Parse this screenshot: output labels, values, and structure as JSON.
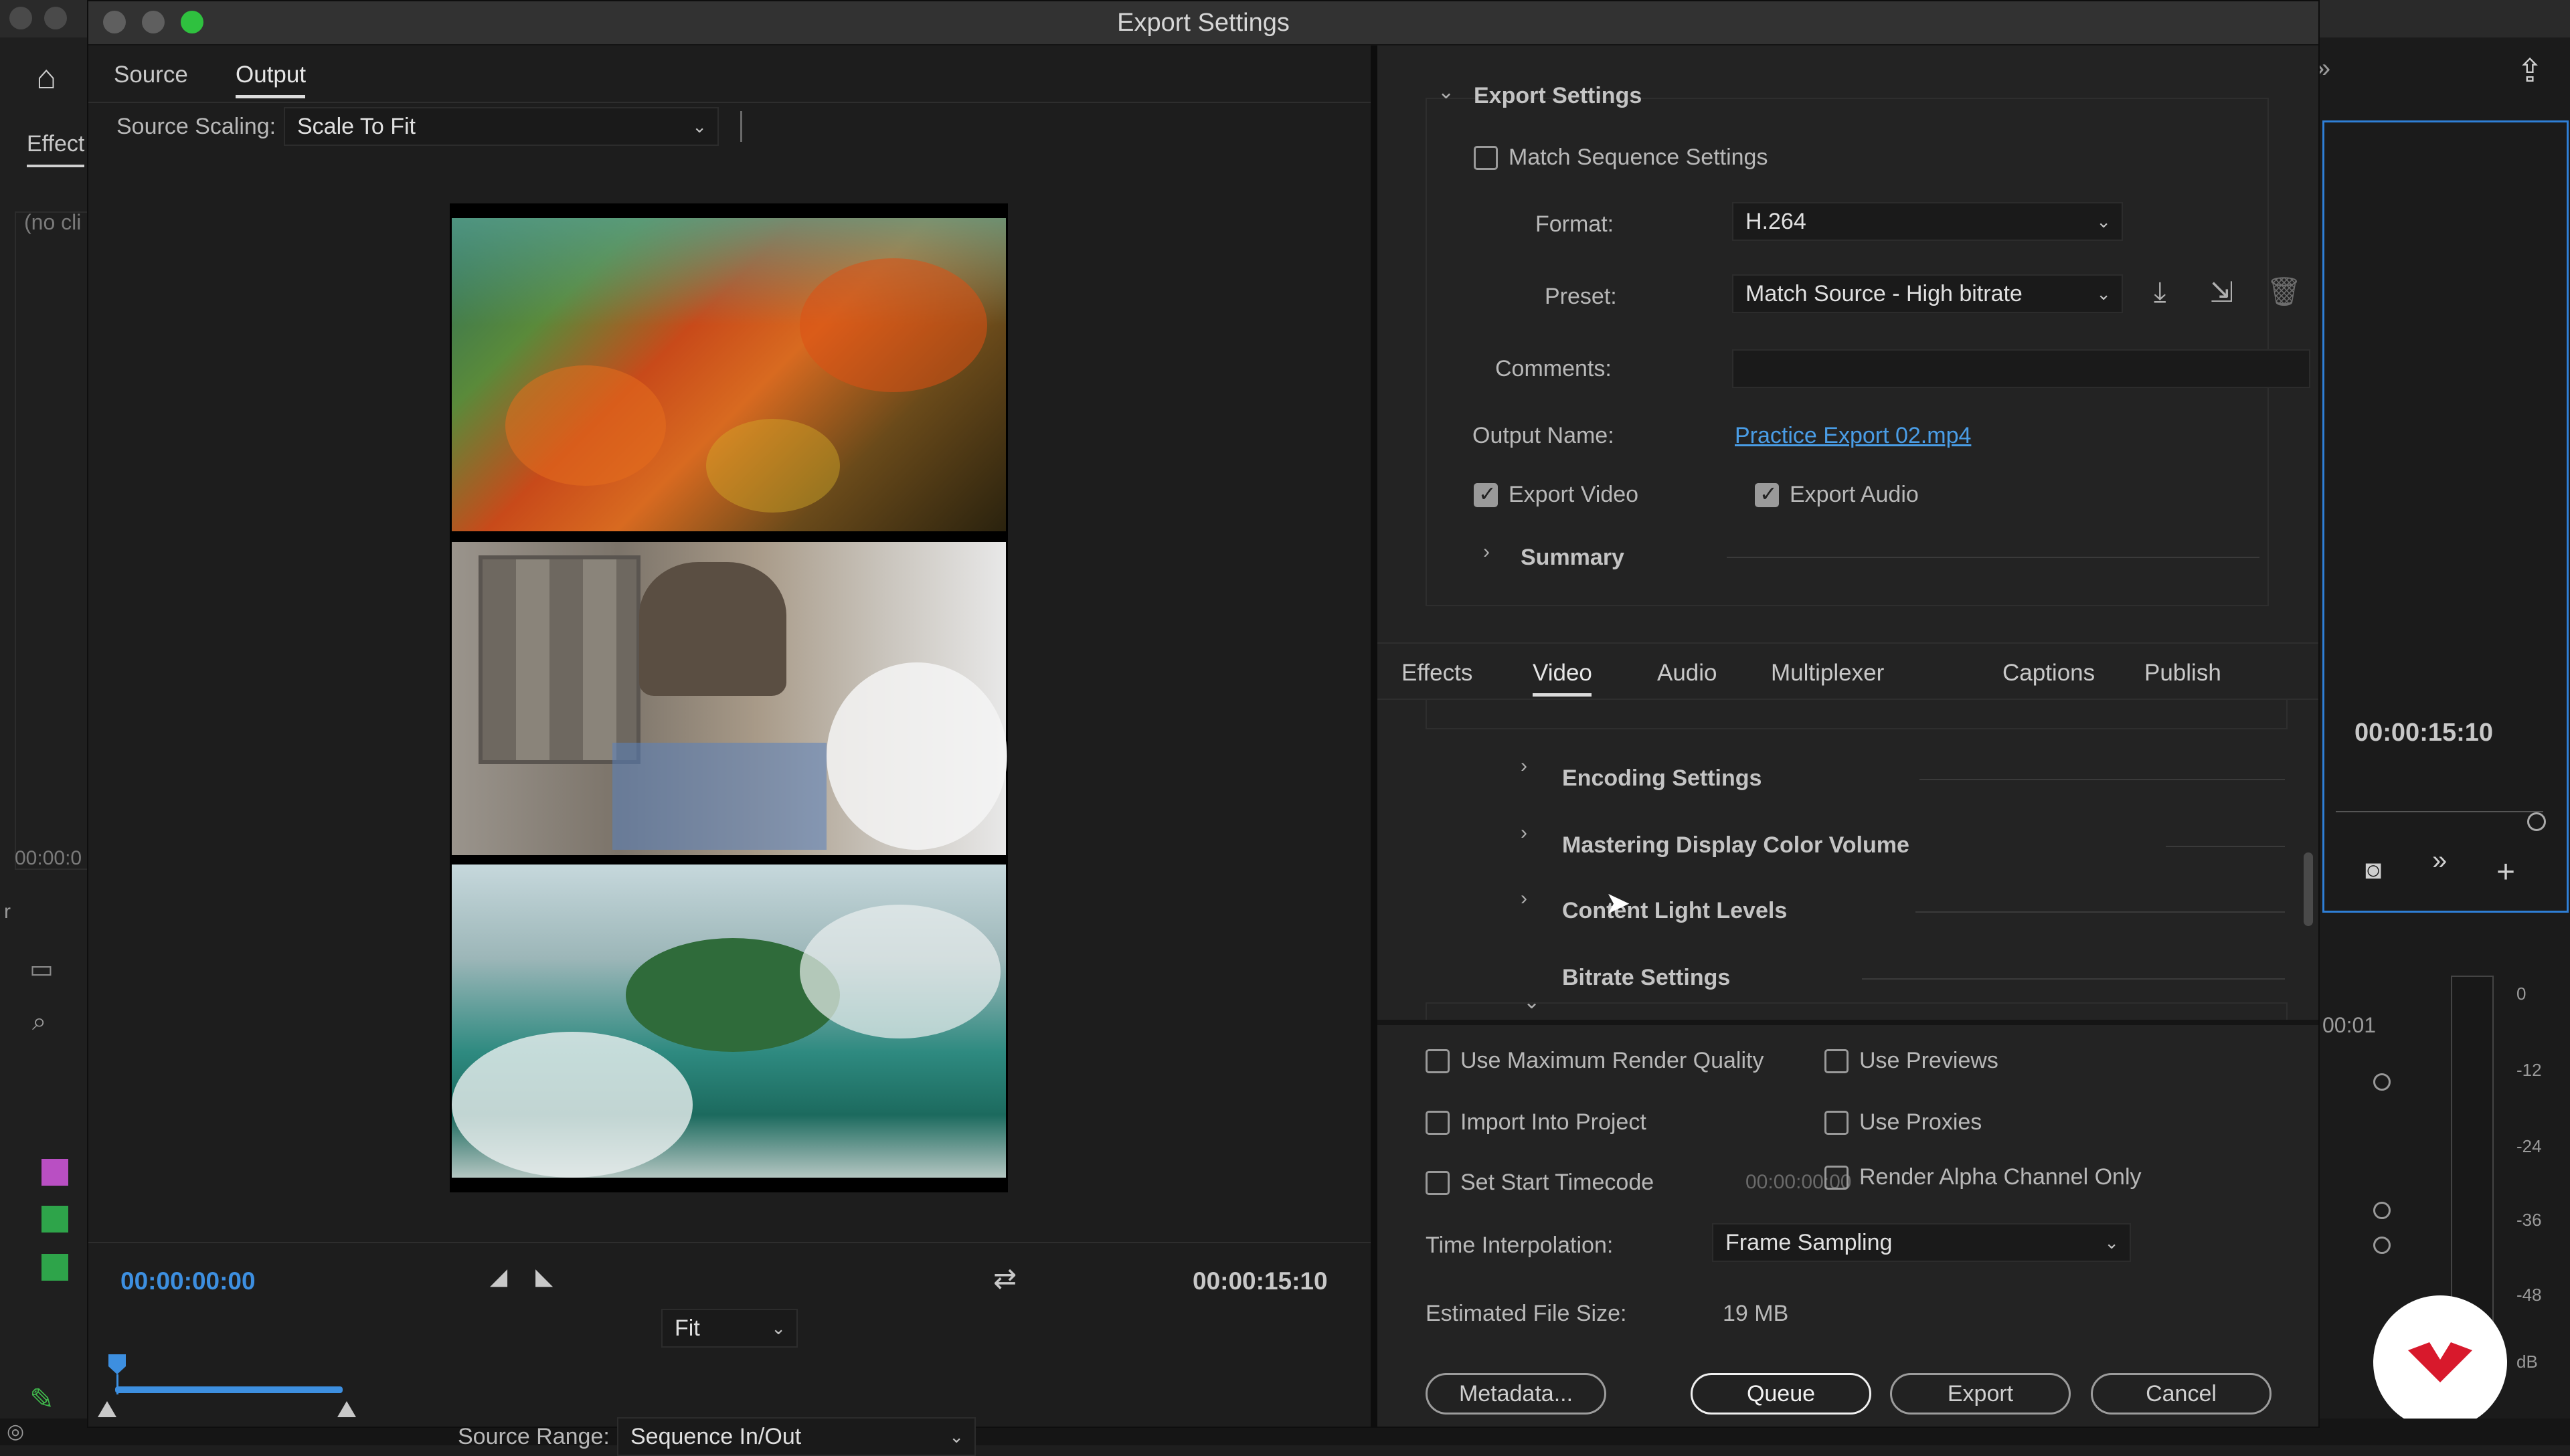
{
  "window": {
    "title": "Export Settings"
  },
  "colors": {
    "accent_blue": "#3d8fe0",
    "link": "#4a9de6",
    "traffic_close": "#6b6b6b",
    "traffic_min": "#6b6b6b",
    "traffic_max": "#2fc13f",
    "logo_red": "#d8192c"
  },
  "background_app": {
    "effect_tab": "Effect",
    "no_clip": "(no cli",
    "timecode_left": "00:00:0",
    "right_timecode": "00:00:15:10",
    "right_time_small": "00:01",
    "meter_labels": [
      "0",
      "-12",
      "-24",
      "-36",
      "-48",
      "dB"
    ],
    "stray_letter": "r"
  },
  "left_pane": {
    "tabs": [
      "Source",
      "Output"
    ],
    "active_tab": "Output",
    "source_scaling_label": "Source Scaling:",
    "source_scaling_value": "Scale To Fit",
    "current_time": "00:00:00:00",
    "end_time": "00:00:15:10",
    "zoom_value": "Fit",
    "source_range_label": "Source Range:",
    "source_range_value": "Sequence In/Out",
    "preview_frames": [
      "orange-flower-field",
      "rocket-launch-tower",
      "misty-island-aerial"
    ]
  },
  "export_settings": {
    "section_title": "Export Settings",
    "match_sequence_label": "Match Sequence Settings",
    "match_sequence_checked": false,
    "format_label": "Format:",
    "format_value": "H.264",
    "preset_label": "Preset:",
    "preset_value": "Match Source - High bitrate",
    "comments_label": "Comments:",
    "comments_value": "",
    "output_name_label": "Output Name:",
    "output_name_value": "Practice Export 02.mp4",
    "export_video_label": "Export Video",
    "export_video_checked": true,
    "export_audio_label": "Export Audio",
    "export_audio_checked": true,
    "summary_label": "Summary"
  },
  "settings_tabs": {
    "items": [
      "Effects",
      "Video",
      "Audio",
      "Multiplexer",
      "Captions",
      "Publish"
    ],
    "active": "Video"
  },
  "video_sections": [
    "Encoding Settings",
    "Mastering Display Color Volume",
    "Content Light Levels",
    "Bitrate Settings"
  ],
  "options": {
    "use_max_render_quality": "Use Maximum Render Quality",
    "use_previews": "Use Previews",
    "import_into_project": "Import Into Project",
    "use_proxies": "Use Proxies",
    "set_start_timecode": "Set Start Timecode",
    "start_timecode_value": "00:00:00:00",
    "render_alpha_only": "Render Alpha Channel Only",
    "time_interpolation_label": "Time Interpolation:",
    "time_interpolation_value": "Frame Sampling",
    "estimated_size_label": "Estimated File Size:",
    "estimated_size_value": "19 MB"
  },
  "buttons": {
    "metadata": "Metadata...",
    "queue": "Queue",
    "export": "Export",
    "cancel": "Cancel"
  }
}
